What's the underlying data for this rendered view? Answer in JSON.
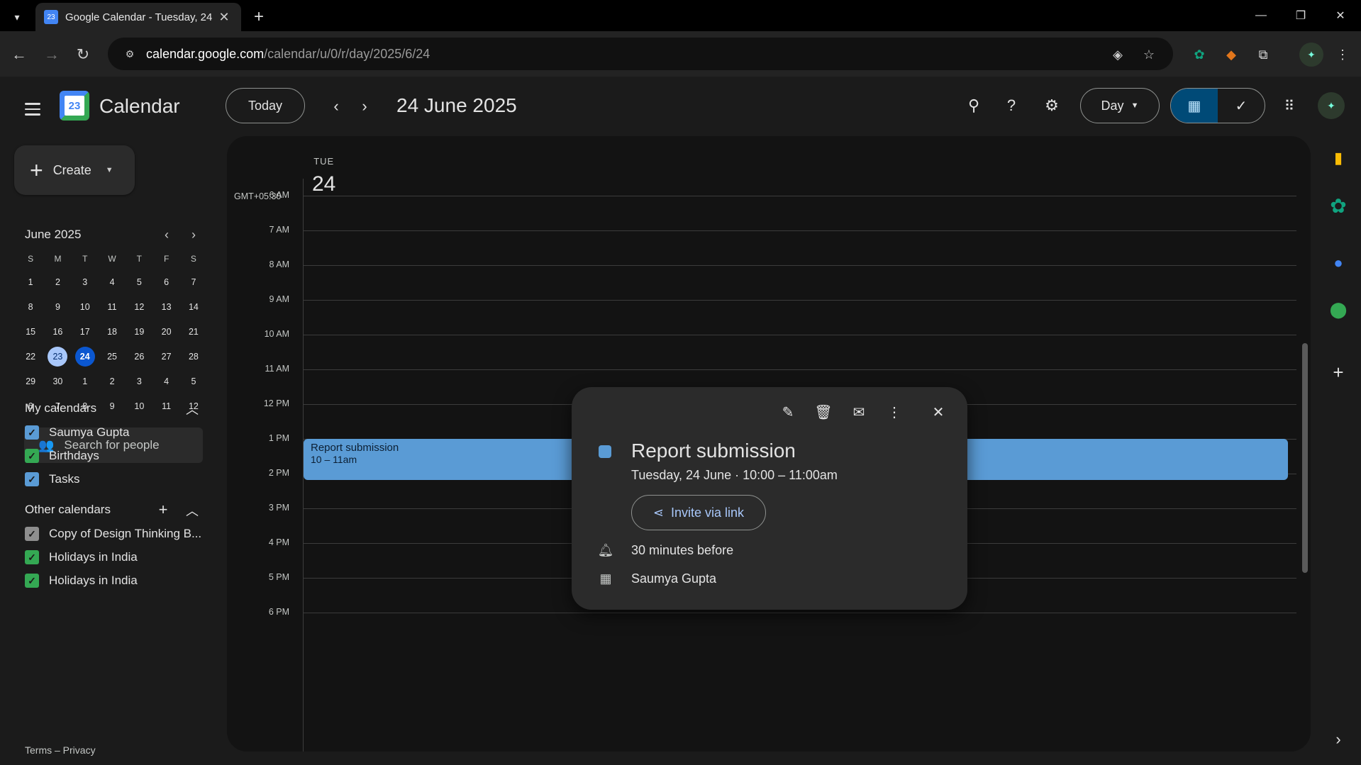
{
  "browser": {
    "tab_title": "Google Calendar - Tuesday, 24",
    "tab_favicon": "23",
    "url_host": "calendar.google.com",
    "url_path": "/calendar/u/0/r/day/2025/6/24"
  },
  "header": {
    "app_title": "Calendar",
    "logo_text": "23",
    "today_label": "Today",
    "date_title": "24 June 2025",
    "view_label": "Day"
  },
  "sidebar": {
    "create_label": "Create",
    "mini_month": "June 2025",
    "dow": [
      "S",
      "M",
      "T",
      "W",
      "T",
      "F",
      "S"
    ],
    "weeks": [
      [
        "1",
        "2",
        "3",
        "4",
        "5",
        "6",
        "7"
      ],
      [
        "8",
        "9",
        "10",
        "11",
        "12",
        "13",
        "14"
      ],
      [
        "15",
        "16",
        "17",
        "18",
        "19",
        "20",
        "21"
      ],
      [
        "22",
        "23",
        "24",
        "25",
        "26",
        "27",
        "28"
      ],
      [
        "29",
        "30",
        "1",
        "2",
        "3",
        "4",
        "5"
      ],
      [
        "6",
        "7",
        "8",
        "9",
        "10",
        "11",
        "12"
      ]
    ],
    "selected_date": "23",
    "today_date": "24",
    "people_search_placeholder": "Search for people",
    "my_calendars_title": "My calendars",
    "my_calendars": [
      {
        "label": "Saumya Gupta",
        "color": "#5a9bd5"
      },
      {
        "label": "Birthdays",
        "color": "#34a853"
      },
      {
        "label": "Tasks",
        "color": "#5a9bd5"
      }
    ],
    "other_calendars_title": "Other calendars",
    "other_calendars": [
      {
        "label": "Copy of Design Thinking B...",
        "color": "#8e8e8e"
      },
      {
        "label": "Holidays in India",
        "color": "#34a853"
      },
      {
        "label": "Holidays in India",
        "color": "#34a853"
      }
    ],
    "footer": "Terms – Privacy"
  },
  "day_view": {
    "dow": "TUE",
    "day_number": "24",
    "timezone": "GMT+05:30",
    "hours": [
      "6 AM",
      "7 AM",
      "8 AM",
      "9 AM",
      "10 AM",
      "11 AM",
      "12 PM",
      "1 PM",
      "2 PM",
      "3 PM",
      "4 PM",
      "5 PM",
      "6 PM"
    ]
  },
  "event": {
    "title": "Report submission",
    "time": "10 – 11am",
    "color": "#5a9bd5"
  },
  "popup": {
    "title": "Report submission",
    "when": "Tuesday, 24 June  ·  10:00 – 11:00am",
    "invite_label": "Invite via link",
    "reminder": "30 minutes before",
    "calendar_owner": "Saumya Gupta"
  }
}
